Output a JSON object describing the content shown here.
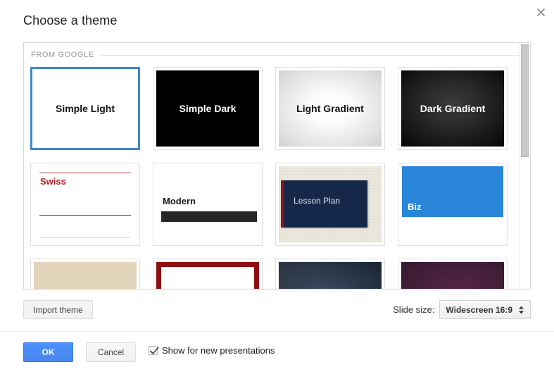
{
  "dialog": {
    "title": "Choose a theme",
    "close_icon": "close-icon"
  },
  "theme_panel": {
    "section_label": "FROM GOOGLE",
    "selected_theme": "Simple Light",
    "themes": [
      {
        "name": "Simple Light",
        "label": "Simple Light",
        "style": "simple-light",
        "selected": true
      },
      {
        "name": "Simple Dark",
        "label": "Simple Dark",
        "style": "simple-dark",
        "selected": false
      },
      {
        "name": "Light Gradient",
        "label": "Light Gradient",
        "style": "light-gradient",
        "selected": false
      },
      {
        "name": "Dark Gradient",
        "label": "Dark Gradient",
        "style": "dark-gradient",
        "selected": false
      },
      {
        "name": "Swiss",
        "label": "Swiss",
        "style": "swiss",
        "selected": false
      },
      {
        "name": "Modern",
        "label": "Modern",
        "style": "modern",
        "selected": false
      },
      {
        "name": "Lesson Plan",
        "label": "Lesson Plan",
        "style": "lesson-plan",
        "selected": false
      },
      {
        "name": "Biz",
        "label": "Biz",
        "style": "biz",
        "selected": false
      },
      {
        "name": "Beige",
        "label": "",
        "style": "beige",
        "selected": false
      },
      {
        "name": "Red Frame",
        "label": "",
        "style": "red-frame",
        "selected": false
      },
      {
        "name": "Navy Dark",
        "label": "",
        "style": "navy-dark",
        "selected": false
      },
      {
        "name": "Purple Dark",
        "label": "",
        "style": "purple-dark",
        "selected": false
      }
    ]
  },
  "options": {
    "import_theme_label": "Import theme",
    "slide_size_label": "Slide size:",
    "slide_size_value": "Widescreen 16:9",
    "slide_size_arrows_icon": "updown-arrows-icon"
  },
  "footer": {
    "ok_label": "OK",
    "cancel_label": "Cancel",
    "show_for_new_label": "Show for new presentations",
    "show_for_new_checked": true
  },
  "colors": {
    "accent_blue": "#4d90fe",
    "selection_blue": "#3b88cf",
    "biz_blue": "#2a86d8",
    "swiss_red": "#b02020",
    "lesson_navy": "#15284a",
    "lesson_beige": "#ece8dd"
  }
}
